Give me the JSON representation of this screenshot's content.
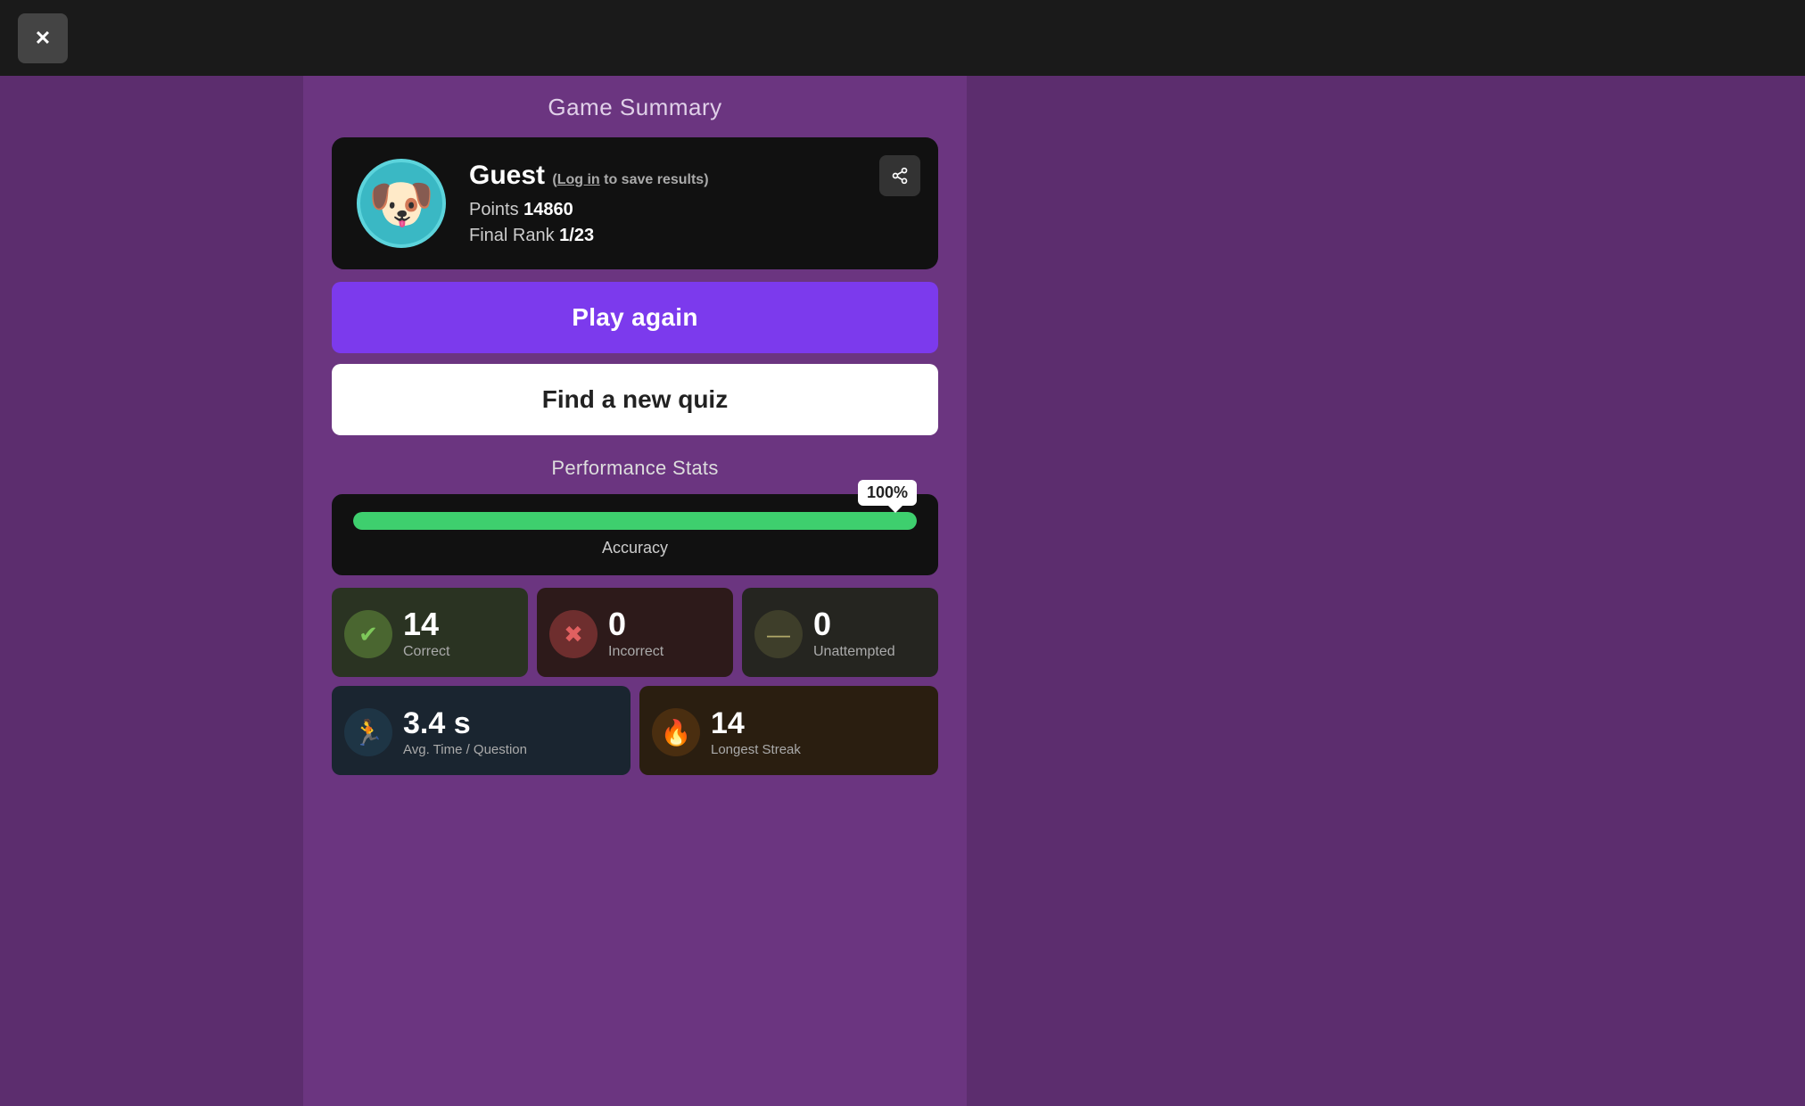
{
  "topbar": {
    "close_label": "✕"
  },
  "header": {
    "title": "Game Summary"
  },
  "profile": {
    "avatar_emoji": "🐶",
    "username": "Guest",
    "login_text": "Log in",
    "login_suffix": " to save results)",
    "login_prefix": "(",
    "points_label": "Points",
    "points_value": "14860",
    "rank_label": "Final Rank",
    "rank_value": "1/23"
  },
  "share_button": {
    "label": "⬆"
  },
  "buttons": {
    "play_again": "Play again",
    "find_quiz": "Find a new quiz"
  },
  "performance": {
    "title": "Performance Stats",
    "accuracy": {
      "percent": "100%",
      "fill_width": "100%",
      "label": "Accuracy"
    },
    "stats": [
      {
        "id": "correct",
        "number": "14",
        "label": "Correct",
        "icon": "✔"
      },
      {
        "id": "incorrect",
        "number": "0",
        "label": "Incorrect",
        "icon": "✖"
      },
      {
        "id": "unattempted",
        "number": "0",
        "label": "Unattempted",
        "icon": "—"
      }
    ],
    "bottom_stats": [
      {
        "id": "avg-time",
        "number": "3.4 s",
        "label": "Avg. Time / Question",
        "icon": "🏃"
      },
      {
        "id": "longest-streak",
        "number": "14",
        "label": "Longest Streak",
        "icon": "🔥"
      }
    ]
  }
}
